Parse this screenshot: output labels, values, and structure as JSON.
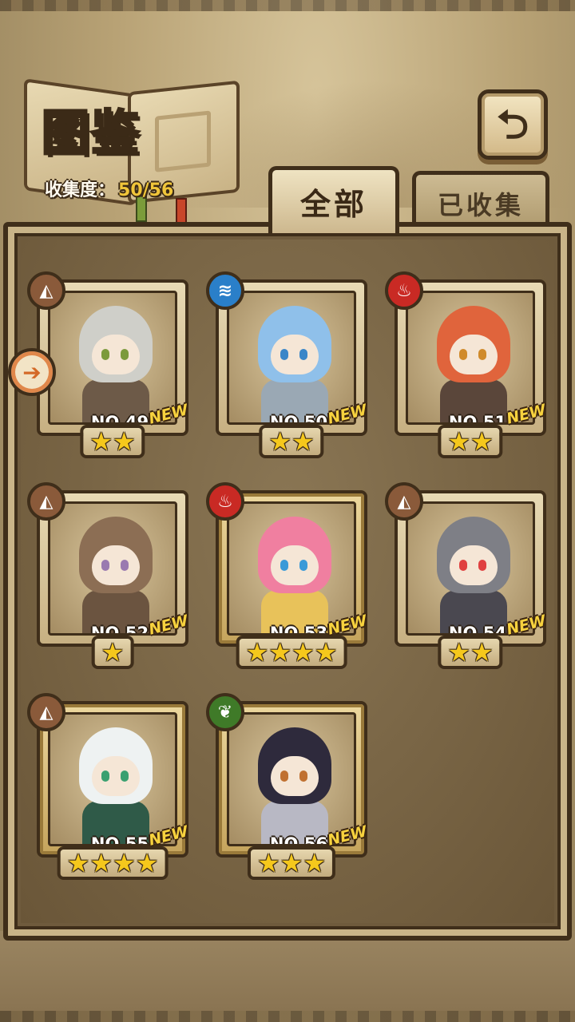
{
  "header": {
    "title": "图鉴",
    "collect_label": "收集度：",
    "collect_value": "50/56",
    "back_icon": "back-arrow-icon"
  },
  "tabs": [
    {
      "label": "全部",
      "active": true
    },
    {
      "label": "已收集",
      "active": false
    }
  ],
  "colors": {
    "earth": "#8a5a3a",
    "water": "#2a7fc9",
    "fire": "#c92a24",
    "wind": "#3f7a28",
    "star": "#f5c81c",
    "new": "#f7d23e"
  },
  "cards": [
    {
      "no": "NO.49",
      "new": "NEW",
      "stars": "★★",
      "element": "earth",
      "hair": "#cfcfc9",
      "cloth": "#6d5a48",
      "eye": "#7c9a3c"
    },
    {
      "no": "NO.50",
      "new": "NEW",
      "stars": "★★",
      "element": "water",
      "hair": "#8fc0ea",
      "cloth": "#9aa8b4",
      "eye": "#3a86c8"
    },
    {
      "no": "NO.51",
      "new": "NEW",
      "stars": "★★",
      "element": "fire",
      "hair": "#e0643c",
      "cloth": "#5a463a",
      "eye": "#d08a2a"
    },
    {
      "no": "NO.52",
      "new": "NEW",
      "stars": "★",
      "element": "earth",
      "hair": "#8c6e54",
      "cloth": "#6b5440",
      "eye": "#9a7ab0"
    },
    {
      "no": "NO.53",
      "new": "NEW",
      "stars": "★★★★",
      "element": "fire",
      "hair": "#f07fa0",
      "cloth": "#e8c25a",
      "eye": "#3a9ad8"
    },
    {
      "no": "NO.54",
      "new": "NEW",
      "stars": "★★",
      "element": "earth",
      "hair": "#7e7f86",
      "cloth": "#4a4850",
      "eye": "#e04040"
    },
    {
      "no": "NO.55",
      "new": "NEW",
      "stars": "★★★★",
      "element": "earth",
      "hair": "#eef2f2",
      "cloth": "#2f5a48",
      "eye": "#3aa070"
    },
    {
      "no": "NO.56",
      "new": "NEW",
      "stars": "★★★",
      "element": "wind",
      "hair": "#2e2a3c",
      "cloth": "#b8b8c4",
      "eye": "#c07030"
    }
  ]
}
